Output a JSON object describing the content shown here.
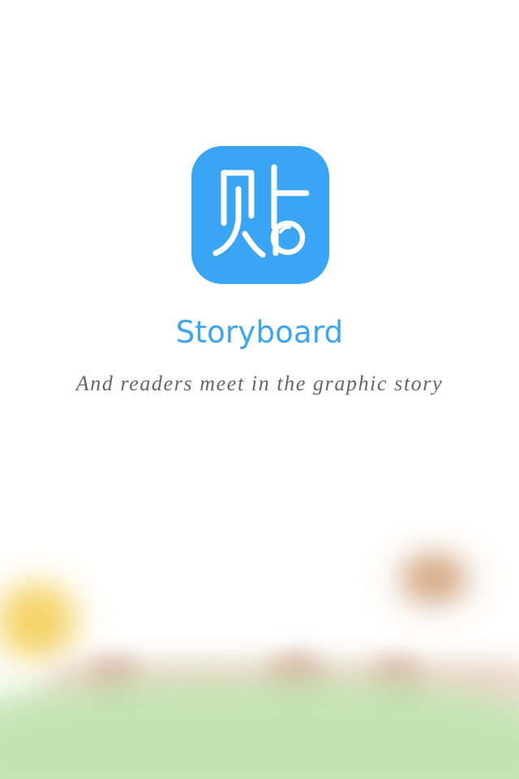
{
  "app": {
    "name": "Storyboard",
    "tagline": "And readers meet in the graphic story",
    "icon": "app-logo-icon"
  },
  "colors": {
    "brand": "#3aa4f5",
    "tagline": "#666666",
    "background": "#ffffff",
    "grass": "#c3e3b2"
  },
  "illustration": {
    "icons": [
      "sun-icon",
      "pumpkin-icon",
      "fence-icon",
      "grass-icon"
    ]
  }
}
